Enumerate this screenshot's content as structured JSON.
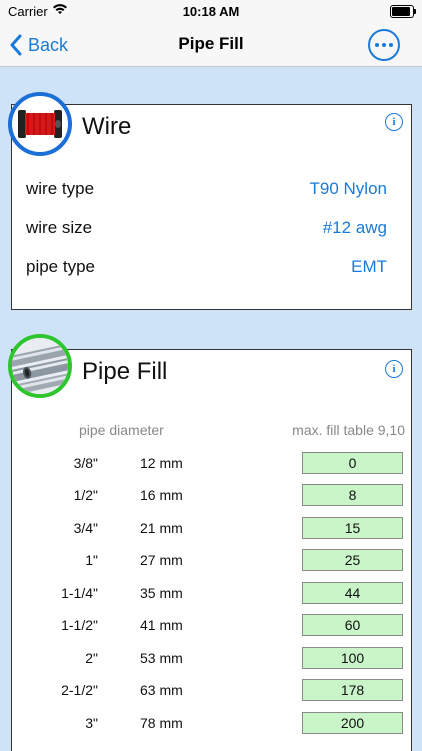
{
  "status": {
    "carrier": "Carrier",
    "time": "10:18 AM"
  },
  "nav": {
    "back_label": "Back",
    "title": "Pipe Fill"
  },
  "wire": {
    "title": "Wire",
    "rows": [
      {
        "label": "wire type",
        "value": "T90 Nylon"
      },
      {
        "label": "wire size",
        "value": "#12 awg"
      },
      {
        "label": "pipe type",
        "value": "EMT"
      }
    ]
  },
  "pipe": {
    "title": "Pipe Fill",
    "header_left": "pipe diameter",
    "header_right": "max. fill table 9,10",
    "rows": [
      {
        "inch": "3/8\"",
        "mm": "12 mm",
        "fill": "0"
      },
      {
        "inch": "1/2\"",
        "mm": "16 mm",
        "fill": "8"
      },
      {
        "inch": "3/4\"",
        "mm": "21 mm",
        "fill": "15"
      },
      {
        "inch": "1\"",
        "mm": "27 mm",
        "fill": "25"
      },
      {
        "inch": "1-1/4\"",
        "mm": "35 mm",
        "fill": "44"
      },
      {
        "inch": "1-1/2\"",
        "mm": "41 mm",
        "fill": "60"
      },
      {
        "inch": "2\"",
        "mm": "53 mm",
        "fill": "100"
      },
      {
        "inch": "2-1/2\"",
        "mm": "63 mm",
        "fill": "178"
      },
      {
        "inch": "3\"",
        "mm": "78 mm",
        "fill": "200"
      }
    ]
  },
  "colors": {
    "accent": "#1a7ad9",
    "wire_ring": "#1b6fd6",
    "pipe_ring": "#2fc52f",
    "fill_bg": "#c9f5c9",
    "page_bg": "#cfe3f7"
  }
}
